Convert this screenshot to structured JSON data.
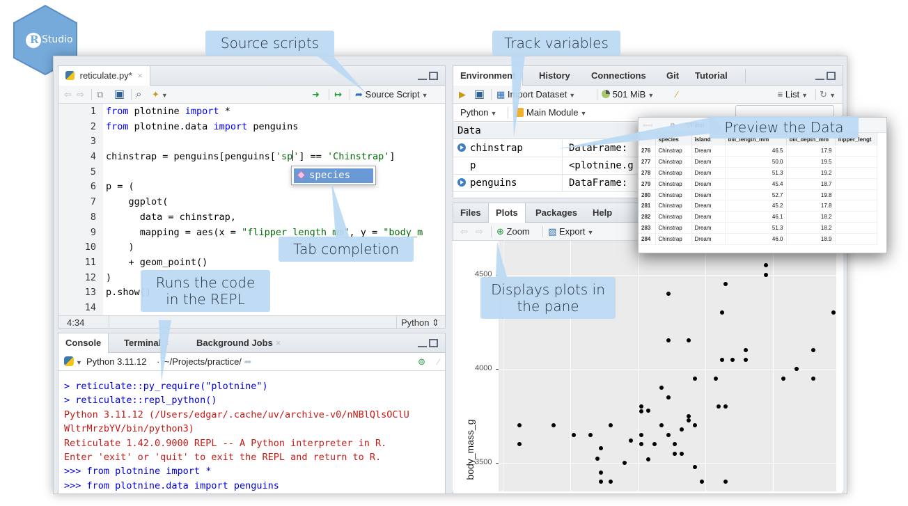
{
  "logo": {
    "letter": "R",
    "text": "Studio",
    "color": "#75aadb"
  },
  "callouts": {
    "source_scripts": "Source scripts",
    "track_variables": "Track variables",
    "preview_data": "Preview the Data",
    "tab_completion": "Tab completion",
    "runs_code_1": "Runs the code",
    "runs_code_2": "in the REPL",
    "displays_plots_1": "Displays plots in",
    "displays_plots_2": "the pane"
  },
  "editor": {
    "tab_label": "reticulate.py*",
    "source_label": "Source Script",
    "cursor_position": "4:34",
    "language": "Python",
    "completion": "species",
    "line_numbers": [
      "1",
      "2",
      "3",
      "4",
      "5",
      "6",
      "7",
      "8",
      "9",
      "10",
      "11",
      "12",
      "13",
      "14"
    ]
  },
  "console": {
    "tabs": [
      "Console",
      "Terminal",
      "Background Jobs"
    ],
    "python_version": "Python 3.11.12",
    "path": "~/Projects/practice/",
    "lines": [
      "> reticulate::py_require(\"plotnine\")",
      "> reticulate::repl_python()",
      "Python 3.11.12 (/Users/edgar/.cache/uv/archive-v0/nNBlQlsOClU",
      "WltrMrzbYV/bin/python3)",
      "Reticulate 1.42.0.9000 REPL -- A Python interpreter in R.",
      "Enter 'exit' or 'quit' to exit the REPL and return to R.",
      ">>> from plotnine import *",
      ">>> from plotnine.data import penguins"
    ]
  },
  "environment": {
    "tabs": [
      "Environment",
      "History",
      "Connections",
      "Git",
      "Tutorial"
    ],
    "import_dataset": "Import Dataset",
    "memory": "501 MiB",
    "view_mode": "List",
    "language": "Python",
    "module": "Main Module",
    "section": "Data",
    "rows": [
      {
        "name": "chinstrap",
        "value": "DataFrame:",
        "expandable": true
      },
      {
        "name": "p",
        "value": "<plotnine.g",
        "expandable": false
      },
      {
        "name": "penguins",
        "value": "DataFrame:",
        "expandable": true
      }
    ]
  },
  "files": {
    "tabs": [
      "Files",
      "Plots",
      "Packages",
      "Help"
    ],
    "zoom": "Zoom",
    "export": "Export"
  },
  "preview": {
    "filter": "Filter",
    "columns": [
      "species",
      "island",
      "bill_length_mm",
      "bill_depth_mm",
      "flipper_lengt"
    ],
    "rows": [
      [
        "276",
        "Chinstrap",
        "Dream",
        "46.5",
        "17.9"
      ],
      [
        "277",
        "Chinstrap",
        "Dream",
        "50.0",
        "19.5"
      ],
      [
        "278",
        "Chinstrap",
        "Dream",
        "51.3",
        "19.2"
      ],
      [
        "279",
        "Chinstrap",
        "Dream",
        "45.4",
        "18.7"
      ],
      [
        "280",
        "Chinstrap",
        "Dream",
        "52.7",
        "19.8"
      ],
      [
        "281",
        "Chinstrap",
        "Dream",
        "45.2",
        "17.8"
      ],
      [
        "282",
        "Chinstrap",
        "Dream",
        "46.1",
        "18.2"
      ],
      [
        "283",
        "Chinstrap",
        "Dream",
        "51.3",
        "18.2"
      ],
      [
        "284",
        "Chinstrap",
        "Dream",
        "46.0",
        "18.9"
      ]
    ]
  },
  "chart_data": {
    "type": "scatter",
    "ylabel": "body_mass_g",
    "yticks": [
      3500,
      4000,
      4500
    ],
    "ylim": [
      3350,
      4680
    ],
    "xlim": [
      0,
      1
    ],
    "grid": true,
    "background": "#ebebeb",
    "points": [
      [
        0.05,
        3700
      ],
      [
        0.05,
        3600
      ],
      [
        0.15,
        3700
      ],
      [
        0.21,
        3650
      ],
      [
        0.26,
        3650
      ],
      [
        0.28,
        3525
      ],
      [
        0.29,
        3580
      ],
      [
        0.29,
        3450
      ],
      [
        0.29,
        3400
      ],
      [
        0.32,
        3400
      ],
      [
        0.32,
        3700
      ],
      [
        0.36,
        3500
      ],
      [
        0.38,
        3620
      ],
      [
        0.41,
        3800
      ],
      [
        0.41,
        3775
      ],
      [
        0.41,
        3650
      ],
      [
        0.41,
        3600
      ],
      [
        0.43,
        3780
      ],
      [
        0.43,
        3520
      ],
      [
        0.45,
        3600
      ],
      [
        0.47,
        3900
      ],
      [
        0.47,
        3700
      ],
      [
        0.49,
        4150
      ],
      [
        0.49,
        4400
      ],
      [
        0.49,
        3650
      ],
      [
        0.49,
        3850
      ],
      [
        0.51,
        3600
      ],
      [
        0.51,
        3550
      ],
      [
        0.53,
        3680
      ],
      [
        0.53,
        3550
      ],
      [
        0.55,
        4150
      ],
      [
        0.55,
        3750
      ],
      [
        0.55,
        3725
      ],
      [
        0.57,
        3950
      ],
      [
        0.57,
        3700
      ],
      [
        0.57,
        3480
      ],
      [
        0.59,
        3400
      ],
      [
        0.61,
        3250
      ],
      [
        0.63,
        3950
      ],
      [
        0.64,
        3800
      ],
      [
        0.65,
        4050
      ],
      [
        0.65,
        4300
      ],
      [
        0.66,
        3800
      ],
      [
        0.66,
        4450
      ],
      [
        0.66,
        3400
      ],
      [
        0.68,
        4050
      ],
      [
        0.72,
        4100
      ],
      [
        0.72,
        4050
      ],
      [
        0.78,
        4550
      ],
      [
        0.78,
        4500
      ],
      [
        0.83,
        3950
      ],
      [
        0.87,
        4000
      ],
      [
        0.92,
        4100
      ],
      [
        0.92,
        3950
      ],
      [
        0.92,
        4650
      ],
      [
        0.98,
        4300
      ]
    ]
  }
}
